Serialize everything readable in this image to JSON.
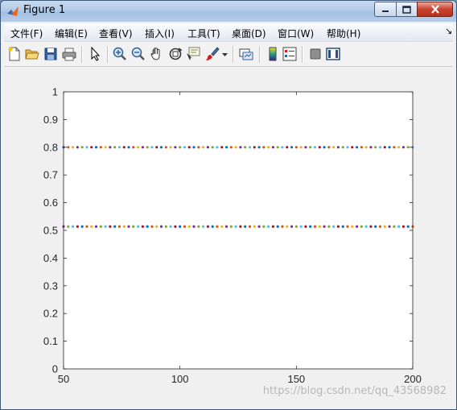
{
  "window": {
    "title": "Figure 1"
  },
  "menu": {
    "items": [
      "文件(F)",
      "编辑(E)",
      "查看(V)",
      "插入(I)",
      "工具(T)",
      "桌面(D)",
      "窗口(W)",
      "帮助(H)"
    ],
    "overflow_arrow": "↘"
  },
  "toolbar": {
    "icons": [
      "new-figure-icon",
      "open-file-icon",
      "save-icon",
      "print-icon",
      "select-arrow-icon",
      "zoom-in-icon",
      "zoom-out-icon",
      "pan-hand-icon",
      "rotate-3d-icon",
      "data-cursor-icon",
      "brush-icon",
      "brush-dropdown-icon",
      "link-plot-icon",
      "colorbar-icon",
      "legend-icon",
      "hide-plot-tools-icon",
      "show-plot-tools-icon"
    ]
  },
  "chart_data": {
    "type": "scatter",
    "title": "",
    "xlabel": "",
    "ylabel": "",
    "xlim": [
      50,
      200
    ],
    "ylim": [
      0,
      1
    ],
    "xticks": [
      "50",
      "100",
      "150",
      "200"
    ],
    "yticks": [
      "0",
      "0.1",
      "0.2",
      "0.3",
      "0.4",
      "0.5",
      "0.6",
      "0.7",
      "0.8",
      "0.9",
      "1"
    ],
    "grid": false,
    "marker": "dot",
    "series_colors": [
      "#0072BD",
      "#D95319",
      "#EDB120",
      "#7E2F8E",
      "#77AC30",
      "#4DBEEE",
      "#A2142F"
    ],
    "series": [
      {
        "x_start": 50,
        "x_end": 200,
        "x_step": 2,
        "y": 0.8
      },
      {
        "x_start": 50,
        "x_end": 200,
        "x_step": 2,
        "y": 0.5137
      }
    ]
  },
  "watermark": "https://blog.csdn.net/qq_43568982"
}
